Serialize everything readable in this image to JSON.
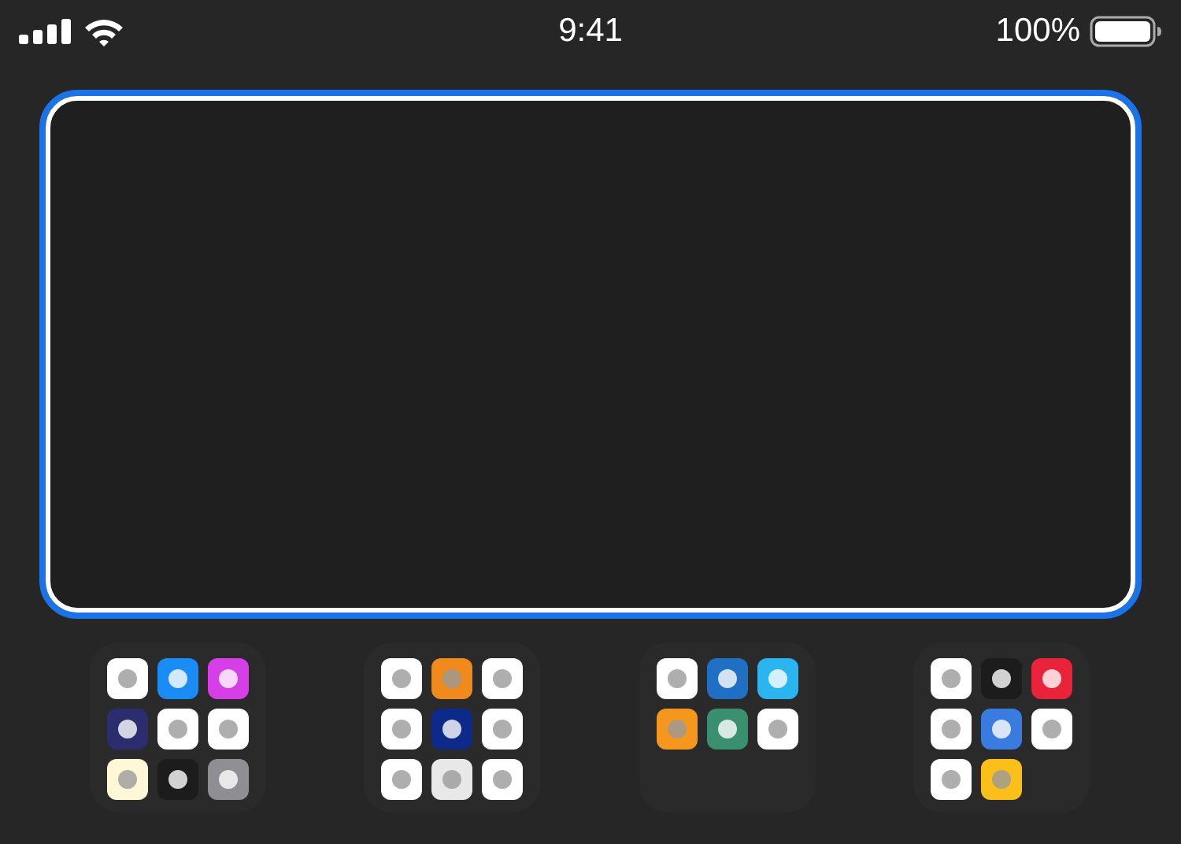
{
  "status_bar": {
    "time": "9:41",
    "battery_percent": "100%"
  },
  "widget_placeholder": {
    "kind": "empty"
  },
  "folders": [
    {
      "apps": [
        {
          "color": "#ffffff"
        },
        {
          "color": "#1a8cf5"
        },
        {
          "color": "#d63ee8"
        },
        {
          "color": "#2b2d6e"
        },
        {
          "color": "#ffffff"
        },
        {
          "color": "#ffffff"
        },
        {
          "color": "#fff7d6"
        },
        {
          "color": "#1c1c1c"
        },
        {
          "color": "#8e8e93"
        }
      ]
    },
    {
      "apps": [
        {
          "color": "#ffffff"
        },
        {
          "color": "#f08a1c"
        },
        {
          "color": "#ffffff"
        },
        {
          "color": "#ffffff"
        },
        {
          "color": "#0d2a8a"
        },
        {
          "color": "#ffffff"
        },
        {
          "color": "#ffffff"
        },
        {
          "color": "#e8e8e8"
        },
        {
          "color": "#ffffff"
        }
      ]
    },
    {
      "apps": [
        {
          "color": "#ffffff"
        },
        {
          "color": "#1f6fc4"
        },
        {
          "color": "#2bb5f0"
        },
        {
          "color": "#f5961f"
        },
        {
          "color": "#3a8f6e"
        },
        {
          "color": "#ffffff"
        }
      ]
    },
    {
      "apps": [
        {
          "color": "#ffffff"
        },
        {
          "color": "#1c1c1c"
        },
        {
          "color": "#e8233a"
        },
        {
          "color": "#ffffff"
        },
        {
          "color": "#3a7be0"
        },
        {
          "color": "#ffffff"
        },
        {
          "color": "#ffffff"
        },
        {
          "color": "#fbbf1a"
        }
      ]
    }
  ]
}
